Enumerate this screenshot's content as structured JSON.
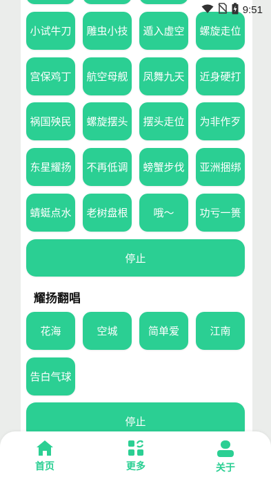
{
  "status_bar": {
    "time": "9:51"
  },
  "grid": [
    [
      "小试牛刀",
      "雕虫小技",
      "遁入虚空",
      "螺旋走位"
    ],
    [
      "宫保鸡丁",
      "航空母舰",
      "凤舞九天",
      "近身硬打"
    ],
    [
      "祸国殃民",
      "螺旋摆头",
      "摆头走位",
      "为非作歹"
    ],
    [
      "东星耀扬",
      "不再低调",
      "螃蟹步伐",
      "亚洲捆绑"
    ],
    [
      "蜻蜓点水",
      "老树盘根",
      "哦～",
      "功亏一篑"
    ]
  ],
  "stop_label_1": "停止",
  "section2": {
    "title": "耀扬翻唱",
    "items": [
      "花海",
      "空城",
      "简单爱",
      "江南",
      "告白气球"
    ],
    "stop_label": "停止"
  },
  "nav": {
    "items": [
      {
        "label": "首页",
        "icon": "home-icon"
      },
      {
        "label": "更多",
        "icon": "apps-icon"
      },
      {
        "label": "关于",
        "icon": "user-icon"
      }
    ]
  },
  "colors": {
    "accent": "#2bcf93",
    "background": "#ebedeb"
  }
}
